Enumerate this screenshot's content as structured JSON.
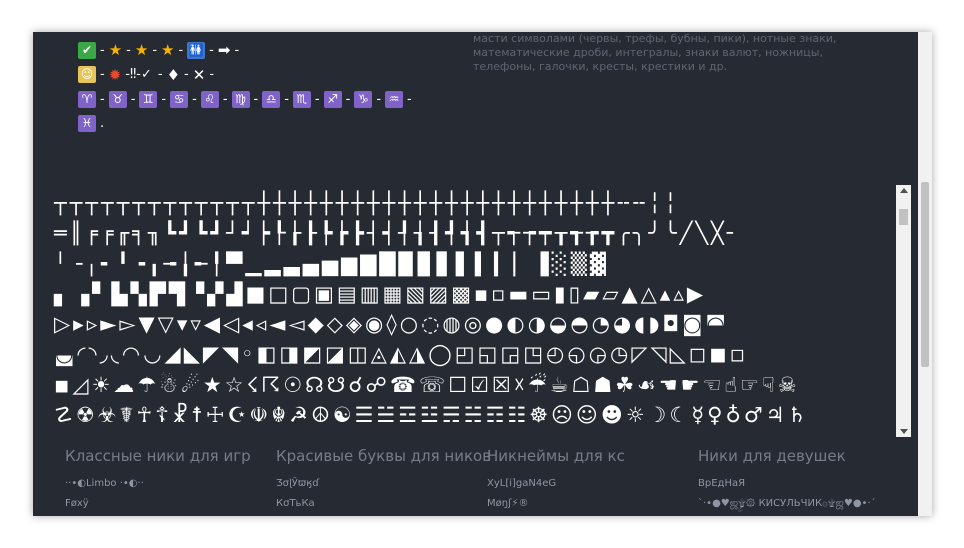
{
  "side_text": "масти символами (червы, трефы, бубны, пики), нотные знаки, математические дроби, интегралы, знаки валют, ножницы, телефоны, галочки, кресты, крестики и др.",
  "emoji_rows": [
    [
      {
        "t": "box",
        "g": "✔",
        "c": "#3aa845"
      },
      {
        "t": "s",
        "g": "-"
      },
      {
        "t": "g",
        "g": "★",
        "c": "#f5b400"
      },
      {
        "t": "s",
        "g": "-"
      },
      {
        "t": "g",
        "g": "★",
        "c": "#f5b400"
      },
      {
        "t": "s",
        "g": "-"
      },
      {
        "t": "g",
        "g": "★",
        "c": "#f5b400"
      },
      {
        "t": "s",
        "g": "-"
      },
      {
        "t": "box",
        "g": "🚻",
        "c": "#3b76d1"
      },
      {
        "t": "s",
        "g": "-"
      },
      {
        "t": "g",
        "g": "➡",
        "c": "#ffffff"
      },
      {
        "t": "s",
        "g": "-"
      }
    ],
    [
      {
        "t": "box",
        "g": "☺",
        "c": "#e7c45a"
      },
      {
        "t": "s",
        "g": "-"
      },
      {
        "t": "g",
        "g": "✹",
        "c": "#e64a2b"
      },
      {
        "t": "s",
        "g": "-‼-✓"
      },
      {
        "t": "s",
        "g": "-"
      },
      {
        "t": "g",
        "g": "♦",
        "c": "#ffffff"
      },
      {
        "t": "s",
        "g": "-"
      },
      {
        "t": "g",
        "g": "✕",
        "c": "#ffffff"
      },
      {
        "t": "s",
        "g": "-"
      }
    ],
    [
      {
        "t": "box",
        "g": "♈",
        "c": "#7f63c9"
      },
      {
        "t": "s",
        "g": "-"
      },
      {
        "t": "box",
        "g": "♉",
        "c": "#7f63c9"
      },
      {
        "t": "s",
        "g": "-"
      },
      {
        "t": "box",
        "g": "♊",
        "c": "#7f63c9"
      },
      {
        "t": "s",
        "g": "-"
      },
      {
        "t": "box",
        "g": "♋",
        "c": "#7f63c9"
      },
      {
        "t": "s",
        "g": "-"
      },
      {
        "t": "box",
        "g": "♌",
        "c": "#7f63c9"
      },
      {
        "t": "s",
        "g": "-"
      },
      {
        "t": "box",
        "g": "♍",
        "c": "#7f63c9"
      },
      {
        "t": "s",
        "g": "-"
      },
      {
        "t": "box",
        "g": "♎",
        "c": "#7f63c9"
      },
      {
        "t": "s",
        "g": "-"
      },
      {
        "t": "box",
        "g": "♏",
        "c": "#7f63c9"
      },
      {
        "t": "s",
        "g": "-"
      },
      {
        "t": "box",
        "g": "♐",
        "c": "#7f63c9"
      },
      {
        "t": "s",
        "g": "-"
      },
      {
        "t": "box",
        "g": "♑",
        "c": "#7f63c9"
      },
      {
        "t": "s",
        "g": "-"
      },
      {
        "t": "box",
        "g": "♒",
        "c": "#7f63c9"
      },
      {
        "t": "s",
        "g": "-"
      }
    ],
    [
      {
        "t": "box",
        "g": "♓",
        "c": "#7f63c9"
      },
      {
        "t": "s",
        "g": "."
      }
    ]
  ],
  "symbols": [
    "┬┬┬┬┬┬┬┬┬┬┬┬┬┼┼┼┼┼┼┼┼┼┼┼┼┼┼┼┼┼┼┼┼┼┼┼╌╌╎╎",
    "═║╒╒╓╕╖┗┛┗┛┘┙┝┞┟┠┡┢┣┤┥┦┧┨┩┪┫┬┭┮┯┰┱┲┳╭╮╯╰╱╲╳╴",
    "╵╶╷╸╹╺╻╼╽╾╿▀▁▂▃▄▅▆▇█▉▊▋▌▍▎▏▐░▒▓",
    "▖▗▘▙▚▛▜▝▞▟■□▢▣▤▥▦▧▨▩▪▫▬▭▮▯▰▱▲△▴▵▶",
    "▷▸▹►▻▼▽▾▿◀◁◂◃◄◅◆◇◈◉◊○◌◍◎●◐◑◒◓◔◕◖◗◘◙◚",
    "◛◜◝◞◟◠◡◢◣◤◥◦◧◨◩◪◫◬◭◮◯◰◱◲◳◴◵◶◷◸◹◺◻◼◽",
    "◾◿☀☁☂☃☄★☆☇☈☉☊☋☌☍☎☏☐☑☒☓☔☕☖☗☘☙☚☛☜☝☞☟☠",
    "☡☢☣☤☥☦☧☨☩☪☫☬☭☮☯☰☱☲☳☴☵☶☷☸☹☺☻☼☽☾☿♀♁♂♃♄"
  ],
  "footer": {
    "columns": [
      {
        "title": "Классные ники для игр",
        "nicks": [
          "··•◐Limbo ·•◐··",
          "Føxÿ"
        ]
      },
      {
        "title": "Красивые буквы для ников",
        "nicks": [
          "ƷσɭӮϖӄɗ",
          "КσТьКа"
        ]
      },
      {
        "title": "Никнеймы для кс",
        "nicks": [
          "XyL[i]gaN4eG",
          "Møŋʃ⚡®"
        ]
      },
      {
        "title": "Ники для девушек",
        "nicks": [
          "ВрЕдНаЯ",
          "`·•●♥ஜ۩ۣۣ۞ КИСУЛЬЧИК۞۩ஜ♥●•·´"
        ]
      }
    ]
  },
  "colors": {
    "bg": "#262a33",
    "accent_purple": "#7f63c9",
    "text_muted": "#767d89"
  }
}
